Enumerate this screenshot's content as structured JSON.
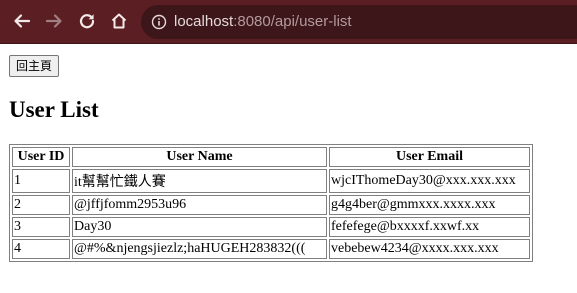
{
  "browser": {
    "url_host": "localhost",
    "url_path": ":8080/api/user-list",
    "back_icon": "arrow-left",
    "forward_icon": "arrow-right",
    "reload_icon": "reload",
    "home_icon": "home",
    "info_icon": "info-circle"
  },
  "page": {
    "home_button_label": "回主頁",
    "title": "User List"
  },
  "table": {
    "headers": [
      "User ID",
      "User Name",
      "User Email"
    ],
    "rows": [
      [
        "1",
        "it幫幫忙鐵人賽",
        "wjcIThomeDay30@xxx.xxx.xxx"
      ],
      [
        "2",
        "@jffjfomm2953u96",
        "g4g4ber@gmmxxx.xxxx.xxx"
      ],
      [
        "3",
        "Day30",
        "fefefege@bxxxxf.xxwf.xx"
      ],
      [
        "4",
        "@#%&njengsjiezlz;haHUGEH283832(((",
        "vebebew4234@xxxx.xxx.xxx"
      ]
    ]
  },
  "colors": {
    "toolbar_bg": "#5a1e23",
    "omnibox_bg": "#3c1619",
    "icon_color": "#f3e9e9",
    "disabled_icon_color": "#a07f82"
  }
}
